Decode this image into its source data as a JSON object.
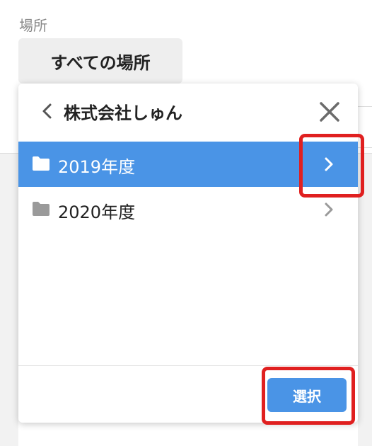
{
  "field": {
    "label": "場所",
    "value": "すべての場所"
  },
  "popup": {
    "title": "株式会社しゅん",
    "folders": [
      {
        "name": "2019年度",
        "selected": true
      },
      {
        "name": "2020年度",
        "selected": false
      }
    ],
    "select_label": "選択"
  },
  "colors": {
    "accent": "#4a94e6",
    "highlight": "#e02020"
  }
}
